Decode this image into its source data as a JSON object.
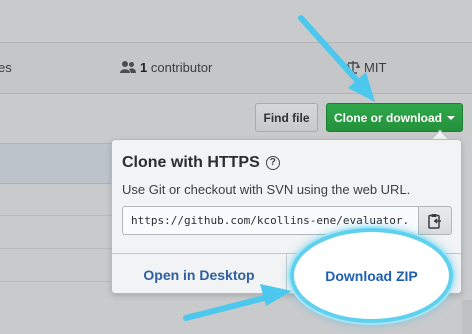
{
  "stats": {
    "branches_fragment": "es",
    "contributors_count": "1",
    "contributors_label": "contributor",
    "license": "MIT"
  },
  "toolbar": {
    "find_file_label": "Find file",
    "clone_label": "Clone or download"
  },
  "clone_panel": {
    "title": "Clone with HTTPS",
    "help_glyph": "?",
    "description": "Use Git or checkout with SVN using the web URL.",
    "url": "https://github.com/kcollins-ene/evaluator.",
    "open_desktop_label": "Open in Desktop",
    "download_zip_label": "Download ZIP"
  },
  "colors": {
    "clone_button": "#28a745",
    "link": "#2f5f9e",
    "annotation_arrow": "#4cc8ef"
  },
  "icons": [
    "people-icon",
    "law-icon",
    "question-icon",
    "clipboard-icon",
    "caret-down-icon"
  ]
}
